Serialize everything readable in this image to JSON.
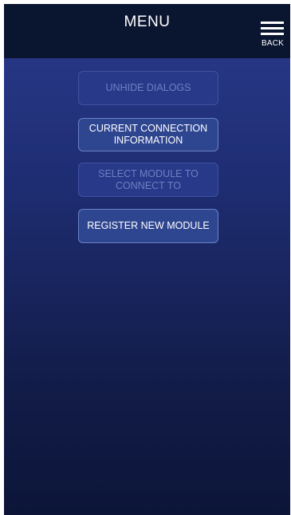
{
  "header": {
    "title": "MENU",
    "back_label": "BACK",
    "back_icon": "hamburger-menu-icon"
  },
  "menu": {
    "items": [
      {
        "label": "UNHIDE DIALOGS",
        "enabled": false
      },
      {
        "label": "CURRENT CONNECTION INFORMATION",
        "enabled": true
      },
      {
        "label": "SELECT MODULE TO CONNECT TO",
        "enabled": false
      },
      {
        "label": "REGISTER NEW MODULE",
        "enabled": true
      }
    ]
  },
  "colors": {
    "header_bg": "#0a1530",
    "background_top": "#2a3a8c",
    "background_bottom": "#0c1538",
    "button_enabled_bg": "#2e4590",
    "button_disabled_text": "#6d7fc0"
  }
}
